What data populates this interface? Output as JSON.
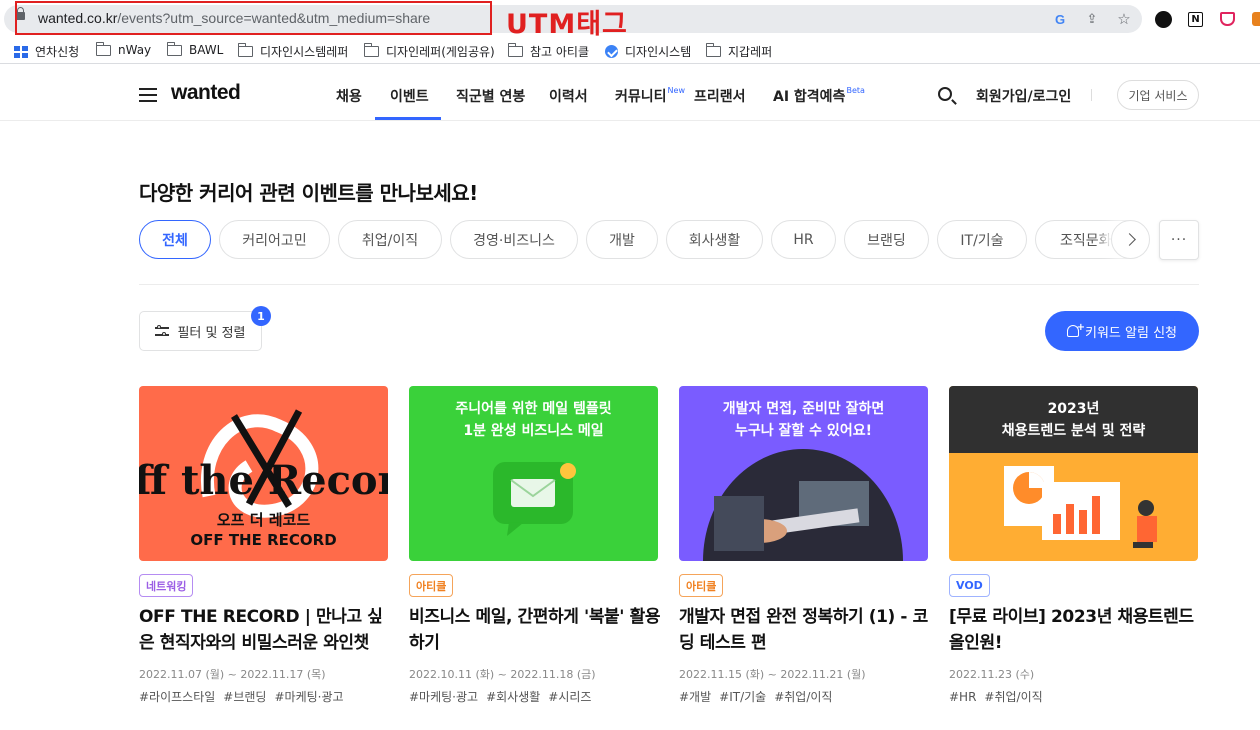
{
  "browser": {
    "url_host": "wanted.co.kr",
    "url_path": "/events?utm_source=wanted&utm_medium=share",
    "annotation": "UTM태그",
    "ext_notion": "N"
  },
  "bookmarks": [
    "연차신청",
    "nWay",
    "BAWL",
    "디자인시스템레퍼",
    "디자인레퍼(게임공유)",
    "참고 아티클",
    "디자인시스템",
    "지갑레퍼"
  ],
  "header": {
    "logo": "wanted",
    "nav": [
      {
        "label": "채용"
      },
      {
        "label": "이벤트"
      },
      {
        "label": "직군별 연봉"
      },
      {
        "label": "이력서"
      },
      {
        "label": "커뮤니티",
        "badge": "New"
      },
      {
        "label": "프리랜서"
      },
      {
        "label": "AI 합격예측",
        "badge": "Beta"
      }
    ],
    "signup": "회원가입/로그인",
    "biz": "기업 서비스"
  },
  "main": {
    "title": "다양한 커리어 관련 이벤트를 만나보세요!",
    "categories": [
      "전체",
      "커리어고민",
      "취업/이직",
      "경영·비즈니스",
      "개발",
      "회사생활",
      "HR",
      "브랜딩",
      "IT/기술",
      "조직문화"
    ],
    "more": "···",
    "filter_label": "필터 및 정렬",
    "filter_count": "1",
    "alert_label": "키워드 알림 신청"
  },
  "cards": [
    {
      "thumb_lines": [
        "오프 더 레코드",
        "OFF THE RECORD"
      ],
      "thumb_art": "Off the Record",
      "tag": "네트워킹",
      "title": "OFF THE RECORD | 만나고 싶은 현직자와의 비밀스러운 와인챗",
      "date": "2022.11.07 (월) ~ 2022.11.17 (목)",
      "hashtags": [
        "#라이프스타일",
        "#브랜딩",
        "#마케팅·광고"
      ]
    },
    {
      "thumb_lines": [
        "주니어를 위한 메일 템플릿",
        "1분 완성 비즈니스 메일"
      ],
      "tag": "아티클",
      "title": "비즈니스 메일, 간편하게 '복붙' 활용하기",
      "date": "2022.10.11 (화) ~ 2022.11.18 (금)",
      "hashtags": [
        "#마케팅·광고",
        "#회사생활",
        "#시리즈"
      ]
    },
    {
      "thumb_lines": [
        "개발자 면접, 준비만 잘하면",
        "누구나 잘할 수 있어요!"
      ],
      "tag": "아티클",
      "title": "개발자 면접 완전 정복하기 (1) - 코딩 테스트 편",
      "date": "2022.11.15 (화) ~ 2022.11.21 (월)",
      "hashtags": [
        "#개발",
        "#IT/기술",
        "#취업/이직"
      ]
    },
    {
      "thumb_lines": [
        "2023년",
        "채용트렌드 분석 및 전략"
      ],
      "tag": "VOD",
      "title": "[무료 라이브] 2023년 채용트렌드 올인원!",
      "date": "2022.11.23 (수)",
      "hashtags": [
        "#HR",
        "#취업/이직"
      ]
    }
  ],
  "colors": {
    "brand": "#3366ff",
    "annotation": "#e02020",
    "card1_bg": "#ff6b4a",
    "card2_bg": "#3ad13a",
    "card3_bg": "#7a5cff",
    "card4_bg": "#ffad33"
  }
}
